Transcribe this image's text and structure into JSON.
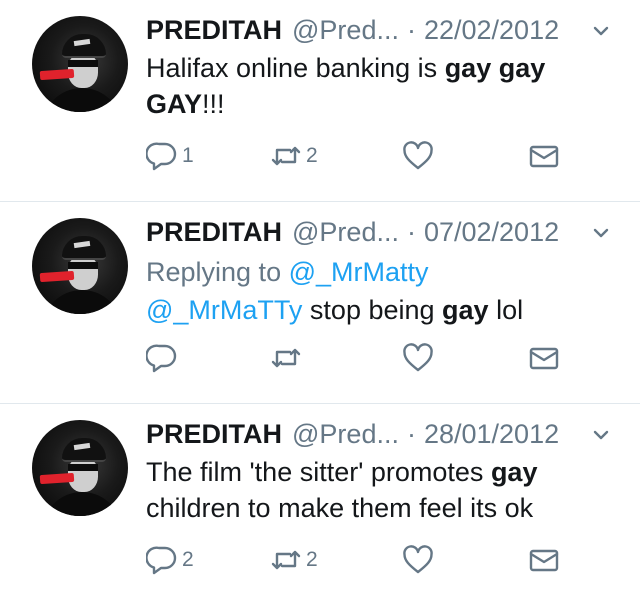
{
  "tweets": [
    {
      "name": "PREDITAH",
      "handle": "@Pred...",
      "date": "22/02/2012",
      "reply_to": null,
      "body_parts": [
        {
          "text": "Halifax online banking is ",
          "style": "normal"
        },
        {
          "text": "gay gay GAY",
          "style": "bold"
        },
        {
          "text": "!!!",
          "style": "normal"
        }
      ],
      "reply_count": "1",
      "retweet_count": "2"
    },
    {
      "name": "PREDITAH",
      "handle": "@Pred...",
      "date": "07/02/2012",
      "reply_to": {
        "label": "Replying to",
        "user": "@_MrMatty"
      },
      "body_parts": [
        {
          "text": "@_MrMaTTy",
          "style": "mention"
        },
        {
          "text": " stop being ",
          "style": "normal"
        },
        {
          "text": "gay",
          "style": "bold"
        },
        {
          "text": " lol",
          "style": "normal"
        }
      ],
      "reply_count": "",
      "retweet_count": ""
    },
    {
      "name": "PREDITAH",
      "handle": "@Pred...",
      "date": "28/01/2012",
      "reply_to": null,
      "body_parts": [
        {
          "text": "The film 'the sitter' promotes ",
          "style": "normal"
        },
        {
          "text": "gay",
          "style": "bold"
        },
        {
          "text": " children to make them feel its ok",
          "style": "normal"
        }
      ],
      "reply_count": "2",
      "retweet_count": "2"
    }
  ],
  "separator": "·",
  "icons": {
    "reply": "reply-icon",
    "retweet": "retweet-icon",
    "like": "heart-icon",
    "dm": "envelope-icon",
    "menu": "chevron-down-icon"
  },
  "colors": {
    "text": "#14171a",
    "muted": "#657786",
    "link": "#1da1f2",
    "border": "#e1e8ed"
  }
}
